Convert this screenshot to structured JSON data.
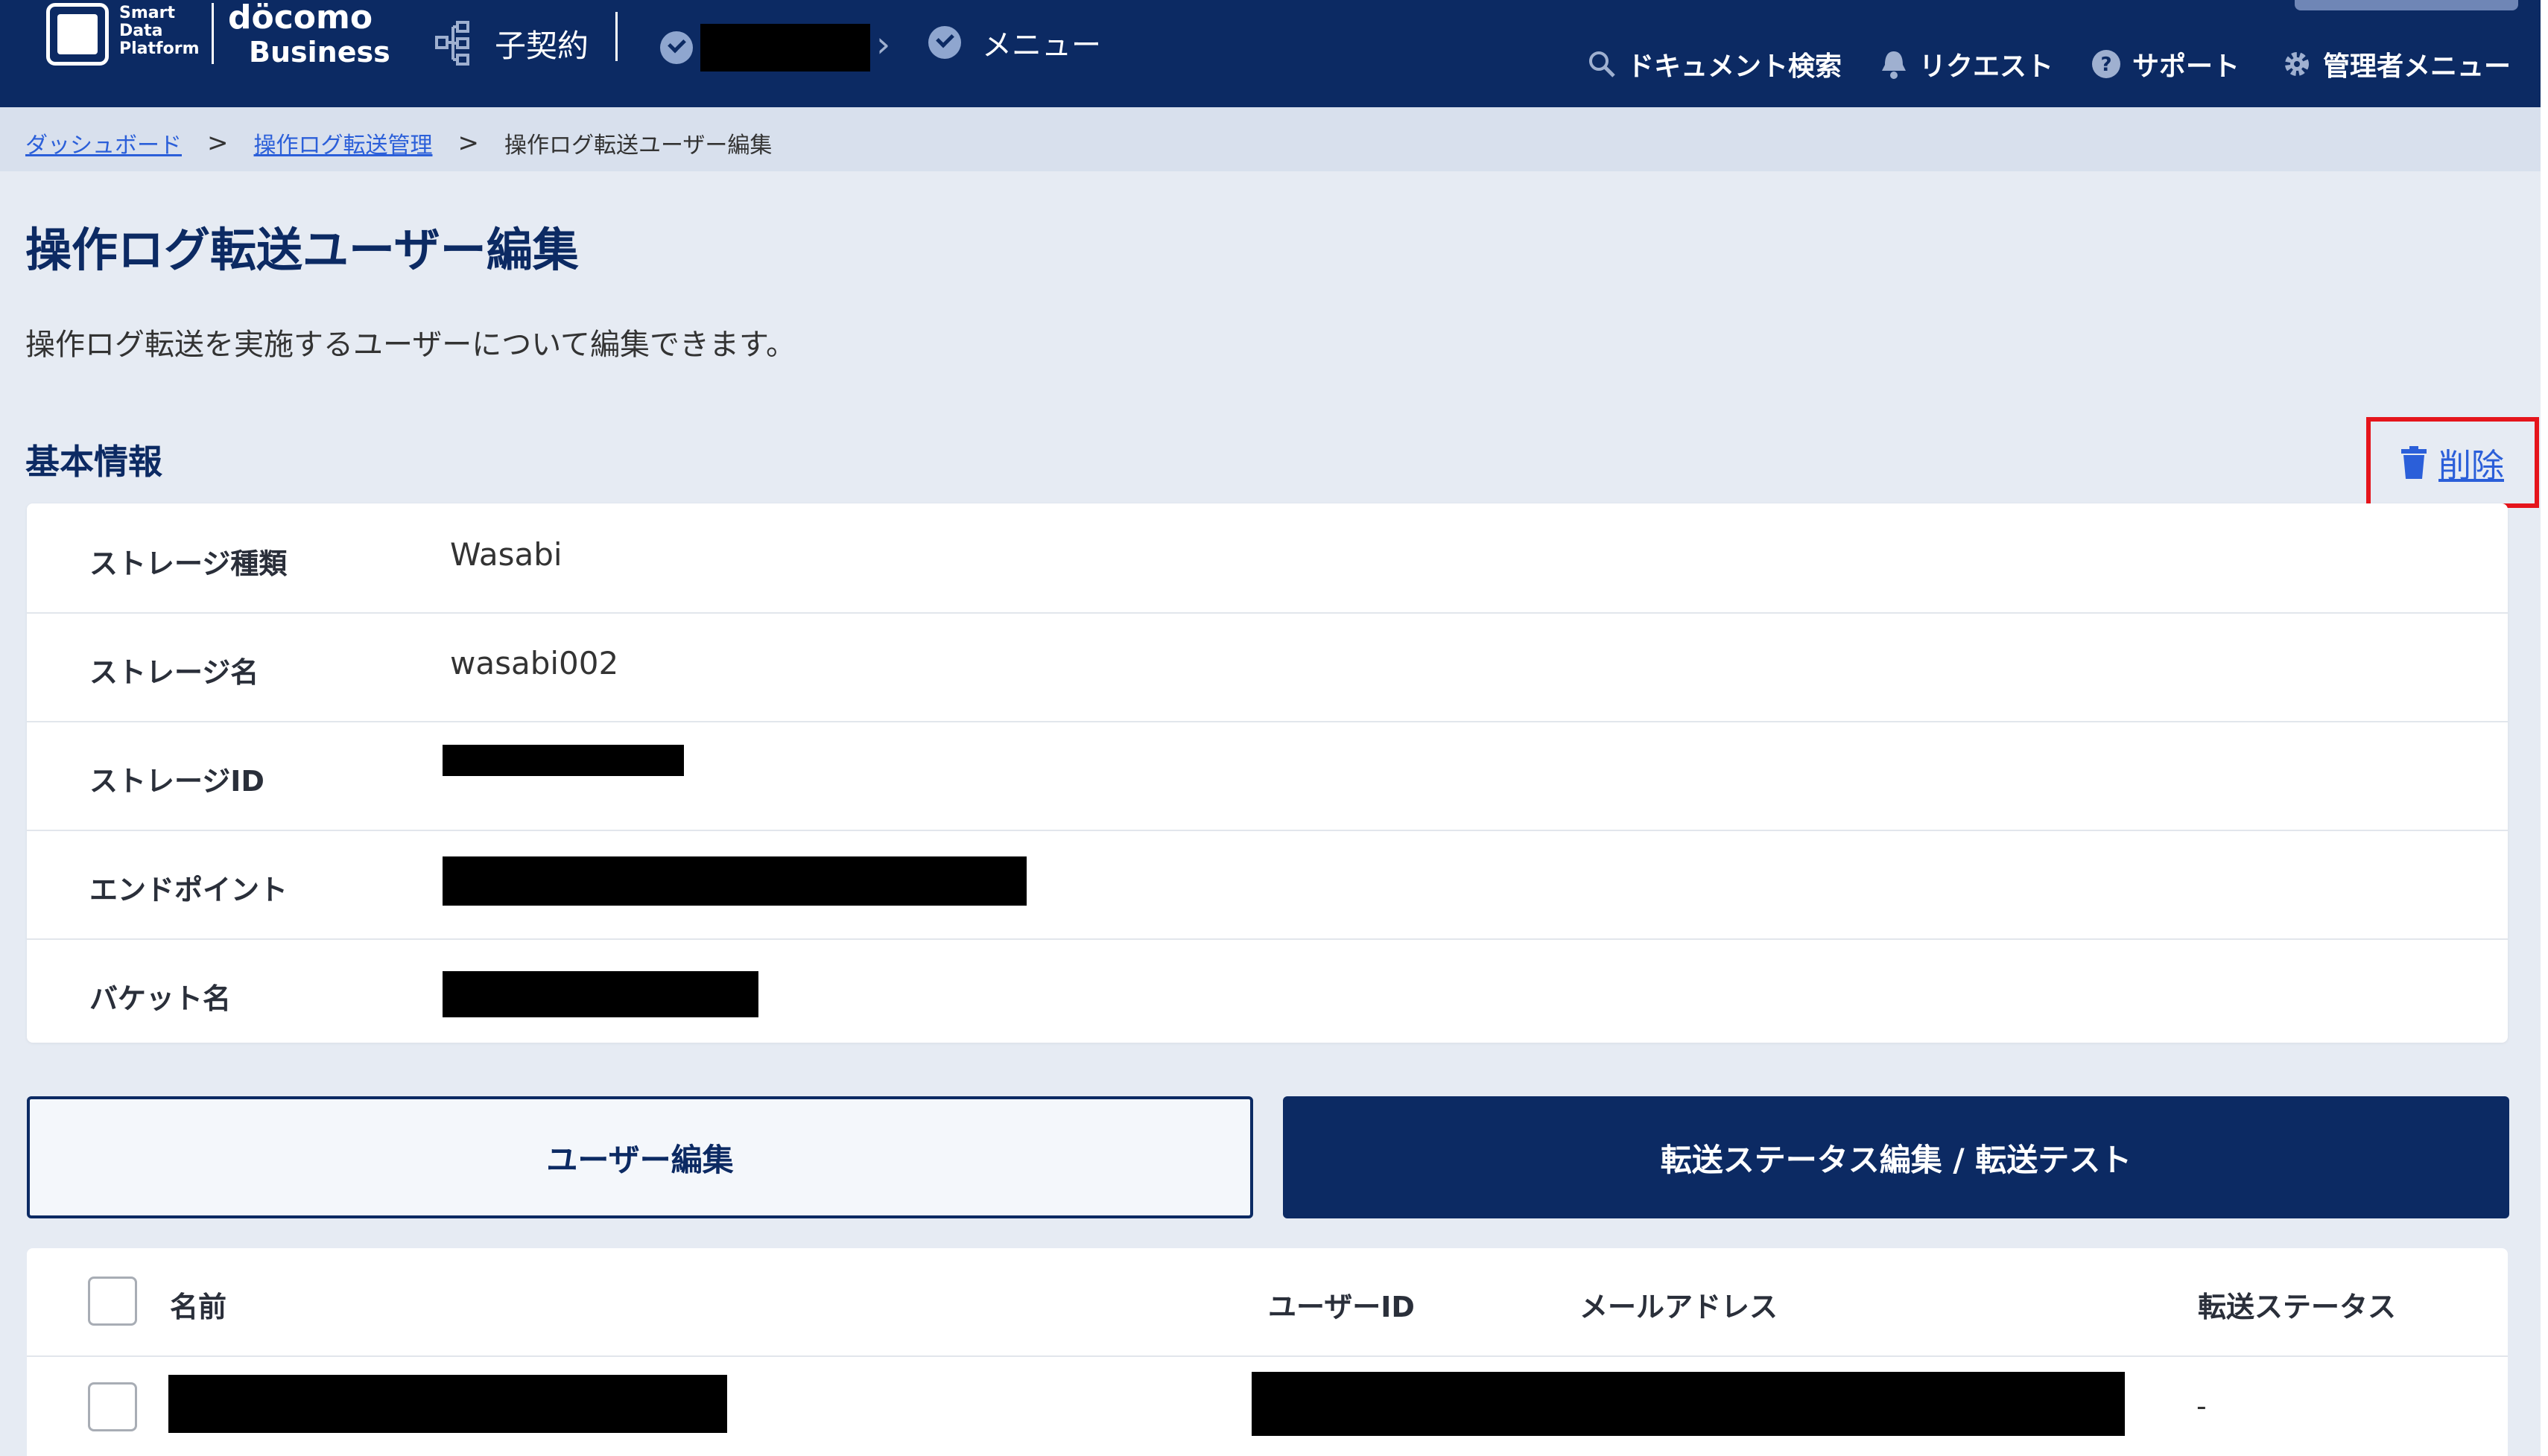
{
  "header": {
    "logo_line1": "Smart",
    "logo_line2": "Data",
    "logo_line3": "Platform",
    "brand_top": "döcomo",
    "brand_bottom": "Business",
    "child_contract": "子契約",
    "menu": "メニュー",
    "utility": {
      "doc_search": "ドキュメント検索",
      "request": "リクエスト",
      "support": "サポート",
      "admin_menu": "管理者メニュー"
    }
  },
  "breadcrumb": {
    "items": [
      "ダッシュボード",
      "操作ログ転送管理",
      "操作ログ転送ユーザー編集"
    ],
    "separator": ">"
  },
  "page": {
    "title": "操作ログ転送ユーザー編集",
    "description": "操作ログ転送を実施するユーザーについて編集できます。",
    "section_title": "基本情報",
    "delete_label": "削除"
  },
  "basic_info": [
    {
      "label": "ストレージ種類",
      "value": "Wasabi"
    },
    {
      "label": "ストレージ名",
      "value": "wasabi002"
    },
    {
      "label": "ストレージID",
      "value": ""
    },
    {
      "label": "エンドポイント",
      "value": ""
    },
    {
      "label": "バケット名",
      "value": ""
    }
  ],
  "tabs": {
    "user_edit": "ユーザー編集",
    "transfer_edit": "転送ステータス編集 / 転送テスト"
  },
  "table": {
    "columns": [
      "名前",
      "ユーザーID",
      "メールアドレス",
      "転送ステータス"
    ],
    "rows": [
      {
        "name": "",
        "user_id": "",
        "email": "",
        "status": "-"
      }
    ]
  },
  "colors": {
    "navy": "#0c2a63",
    "link": "#2b5fd9",
    "highlight": "#e5141b",
    "background": "#e6ebf3"
  }
}
